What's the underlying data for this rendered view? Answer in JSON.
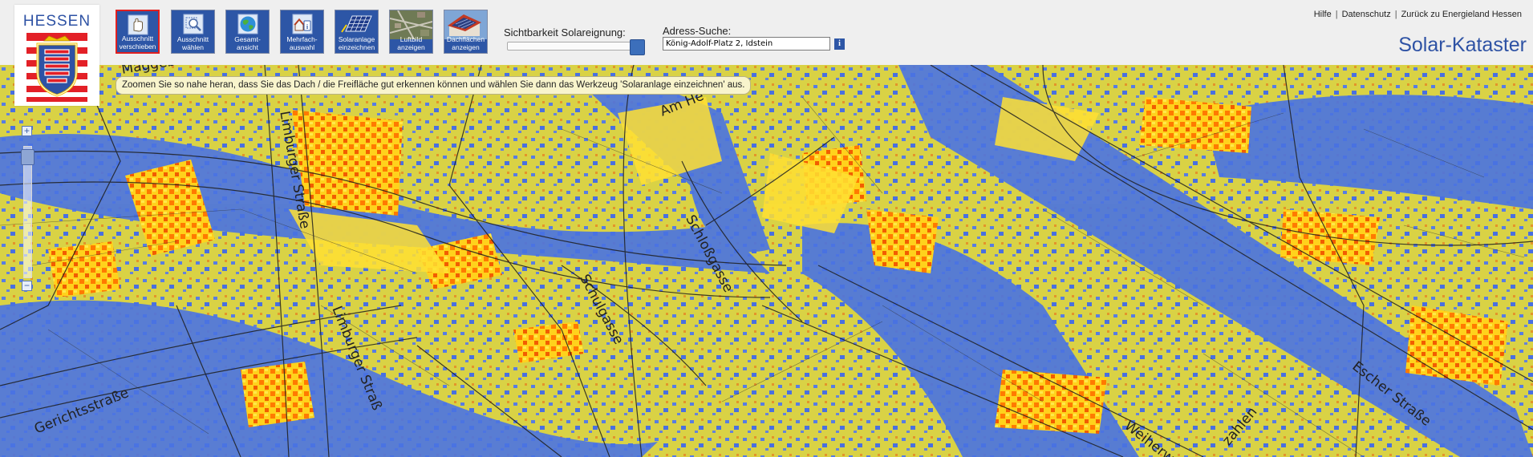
{
  "logo": {
    "text": "HESSEN"
  },
  "toolbar": {
    "tools": [
      {
        "label_line1": "Ausschnitt",
        "label_line2": "verschieben",
        "icon": "hand-icon",
        "active": true
      },
      {
        "label_line1": "Ausschnitt",
        "label_line2": "wählen",
        "icon": "magnifier-icon",
        "active": false
      },
      {
        "label_line1": "Gesamt-",
        "label_line2": "ansicht",
        "icon": "globe-icon",
        "active": false
      },
      {
        "label_line1": "Mehrfach-",
        "label_line2": "auswahl",
        "icon": "multi-select-icon",
        "active": false
      },
      {
        "label_line1": "Solaranlage",
        "label_line2": "einzeichnen",
        "icon": "solar-panel-icon",
        "active": false
      },
      {
        "label_line1": "Luftbild",
        "label_line2": "anzeigen",
        "icon": "aerial-photo-icon",
        "active": false
      },
      {
        "label_line1": "Dachflächen",
        "label_line2": "anzeigen",
        "icon": "roof-icon",
        "active": false
      }
    ]
  },
  "visibility": {
    "label": "Sichtbarkeit Solareignung:",
    "value_fraction": 1.0
  },
  "address": {
    "label": "Adress-Suche:",
    "value": "König-Adolf-Platz 2, Idstein",
    "info": "i"
  },
  "links": {
    "help": "Hilfe",
    "privacy": "Datenschutz",
    "back": "Zurück zu Energieland Hessen"
  },
  "title": "Solar-Kataster",
  "map": {
    "hint": "Zoomen Sie so nahe heran, dass Sie das Dach / die Freifläche gut erkennen können und wählen Sie dann das Werkzeug 'Solaranlage einzeichnen' aus.",
    "zoom_in": "+",
    "zoom_out": "−",
    "streets": {
      "maggeburg": "Maggebu",
      "limburger1": "Limburger Straße",
      "am_he": "Am He",
      "schlossgasse": "Schloßgasse",
      "schulgasse": "Schulgasse",
      "gerichtsstrasse": "Gerichtsstraße",
      "limburger2": "Limburger Straß",
      "weiherwiese": "Weiherw",
      "zahlen": "zahlen",
      "escher": "Escher Straße"
    },
    "colors": {
      "high": "#ff7a00",
      "mid": "#ffe820",
      "low": "#3f6fe0"
    }
  }
}
